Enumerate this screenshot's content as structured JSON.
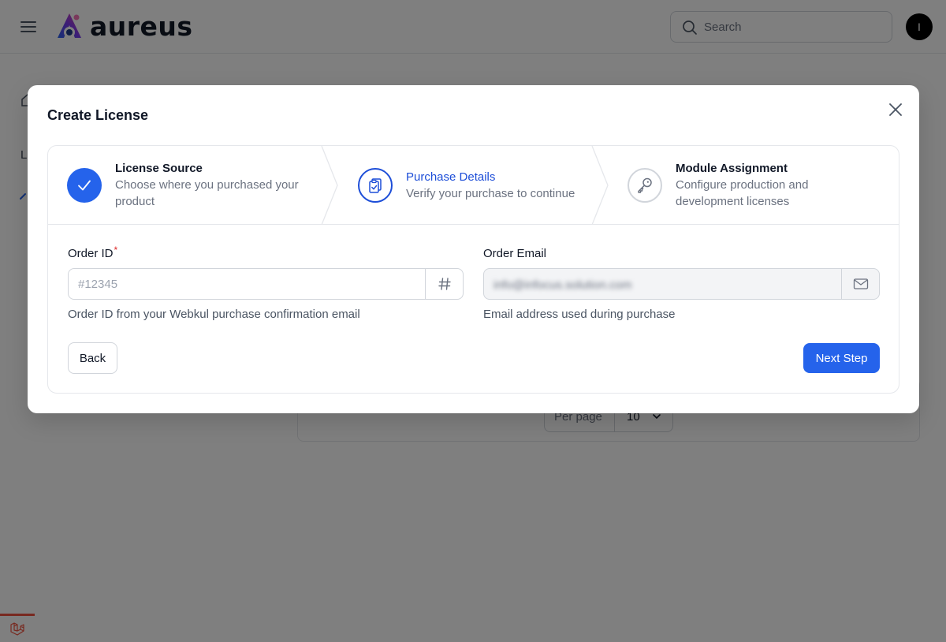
{
  "header": {
    "brand": "aureus",
    "search_placeholder": "Search",
    "avatar_initial": "I"
  },
  "sidebar": {
    "section_letter": "L"
  },
  "background": {
    "per_page_label": "Per page",
    "per_page_value": "10"
  },
  "modal": {
    "title": "Create License",
    "steps": [
      {
        "title": "License Source",
        "description": "Choose where you purchased your product",
        "status": "complete",
        "icon": "check-icon"
      },
      {
        "title": "Purchase Details",
        "description": "Verify your purchase to continue",
        "status": "current",
        "icon": "clipboard-check-icon"
      },
      {
        "title": "Module Assignment",
        "description": "Configure production and development licenses",
        "status": "upcoming",
        "icon": "key-icon"
      }
    ],
    "fields": {
      "order_id": {
        "label": "Order ID",
        "required_mark": "*",
        "placeholder": "#12345",
        "value": "",
        "help": "Order ID from your Webkul purchase confirmation email",
        "addon_icon": "hash-icon"
      },
      "order_email": {
        "label": "Order Email",
        "value": "info@infocus.solution.com",
        "help": "Email address used during purchase",
        "addon_icon": "mail-icon"
      }
    },
    "buttons": {
      "back": "Back",
      "next": "Next Step"
    }
  },
  "colors": {
    "primary": "#2563eb",
    "primary_dark": "#1d4ed8",
    "required": "#dc2626",
    "laravel": "#f05340"
  }
}
